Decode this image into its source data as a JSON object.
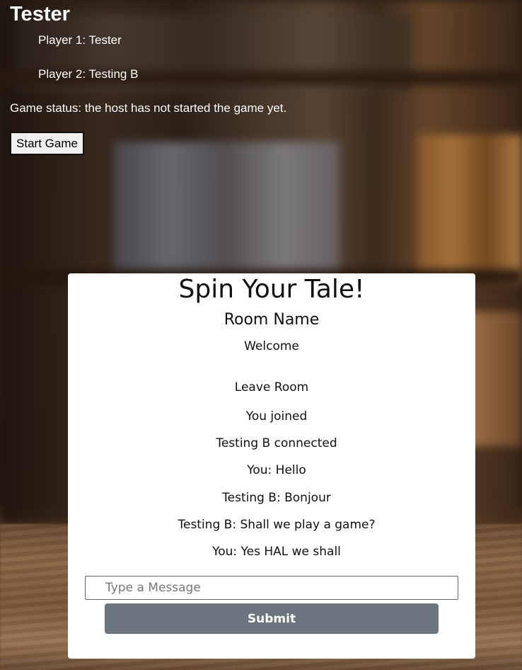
{
  "header": {
    "title": "Tester",
    "players": [
      "Player 1: Tester",
      "Player 2: Testing B"
    ],
    "game_status": "Game status: the host has not started the game yet.",
    "start_button": "Start Game"
  },
  "chat": {
    "title": "Spin Your Tale!",
    "room_name": "Room Name",
    "welcome": "Welcome",
    "leave_label": "Leave Room",
    "messages": [
      "You joined",
      "Testing B connected",
      "You: Hello",
      "Testing B: Bonjour",
      "Testing B: Shall we play a game?",
      "You: Yes HAL we shall"
    ],
    "input": {
      "placeholder": "Type a Message",
      "value": ""
    },
    "submit_label": "Submit"
  },
  "colors": {
    "panel_bg": "#ffffff",
    "submit_bg": "#6c757d",
    "text_light": "#ffffff"
  }
}
